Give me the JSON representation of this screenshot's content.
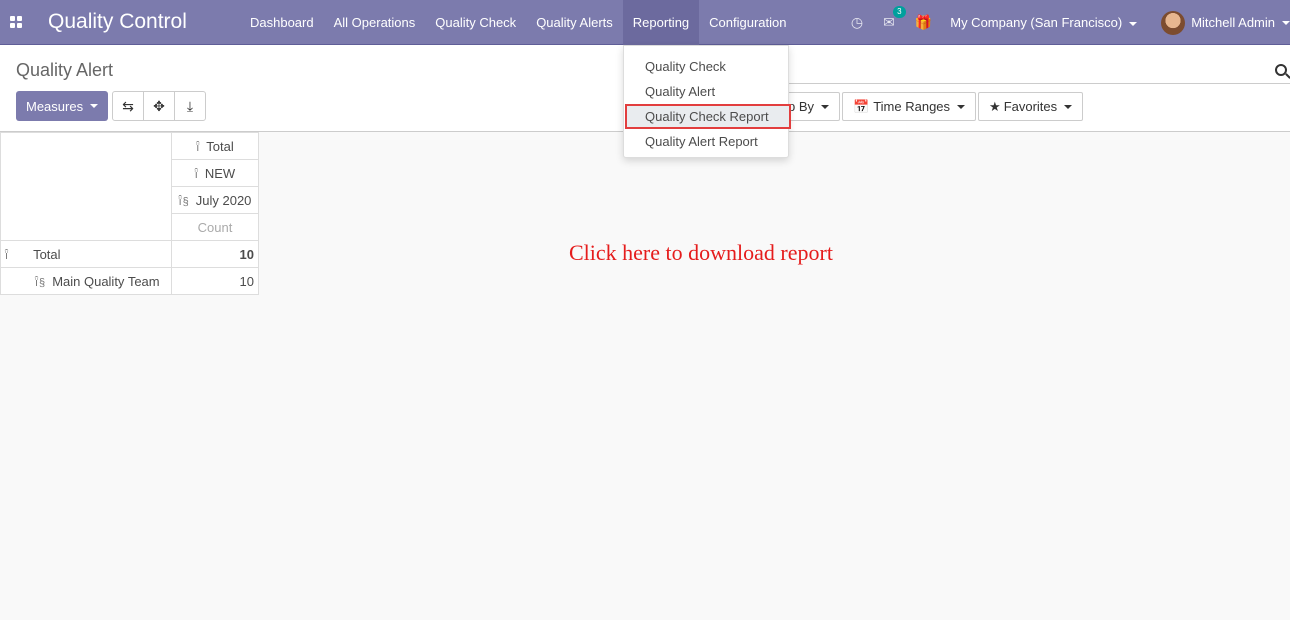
{
  "navbar": {
    "brand": "Quality Control",
    "menu": [
      "Dashboard",
      "All Operations",
      "Quality Check",
      "Quality Alerts",
      "Reporting",
      "Configuration"
    ],
    "active": "Reporting",
    "chat_badge": "3",
    "company": "My Company (San Francisco)",
    "user": "Mitchell Admin"
  },
  "control": {
    "title": "Quality Alert",
    "measures_label": "Measures",
    "group_by_label": "p By",
    "time_ranges_label": "Time Ranges",
    "favorites_label": "Favorites"
  },
  "dropdown": {
    "items": [
      "Quality Check",
      "Quality Alert",
      "Quality Check Report",
      "Quality Alert Report"
    ],
    "highlighted": "Quality Check Report"
  },
  "pivot": {
    "col_headers": [
      "Total",
      "NEW",
      "July 2020"
    ],
    "measure": "Count",
    "rows": [
      {
        "label": "Total",
        "value": "10"
      },
      {
        "label": "Main Quality Team",
        "value": "10"
      }
    ],
    "glyph_minus": "ï̂",
    "glyph_plus": "ï̂§"
  },
  "annotation": "Click here to download report",
  "colors": {
    "primary": "#7c7bad",
    "annotation": "#e51c1c",
    "highlight_border": "#e23e3e"
  }
}
